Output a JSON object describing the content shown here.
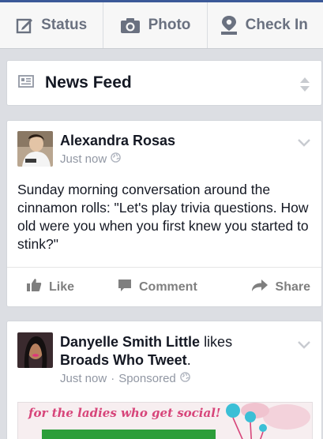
{
  "topbar": {
    "status_label": "Status",
    "photo_label": "Photo",
    "checkin_label": "Check In"
  },
  "newsfeed": {
    "title": "News Feed"
  },
  "posts": [
    {
      "author": "Alexandra Rosas",
      "time": "Just now",
      "text": "Sunday morning conversation around the cinnamon rolls: \"Let's play trivia questions. How old were you when you first knew you started to stink?\"",
      "like_label": "Like",
      "comment_label": "Comment",
      "share_label": "Share"
    },
    {
      "author": "Danyelle Smith Little",
      "verb": "likes",
      "page": "Broads Who Tweet",
      "time": "Just now",
      "separator": "·",
      "sponsored": "Sponsored",
      "ad_tagline": "for the ladies who get social!"
    }
  ],
  "colors": {
    "brand": "#3b5998",
    "icon_gray": "#6a7180",
    "meta_gray": "#9197a3",
    "ad_pink": "#d7457a",
    "ad_green": "#2c9e3a",
    "ad_teal": "#3bbfd6"
  }
}
